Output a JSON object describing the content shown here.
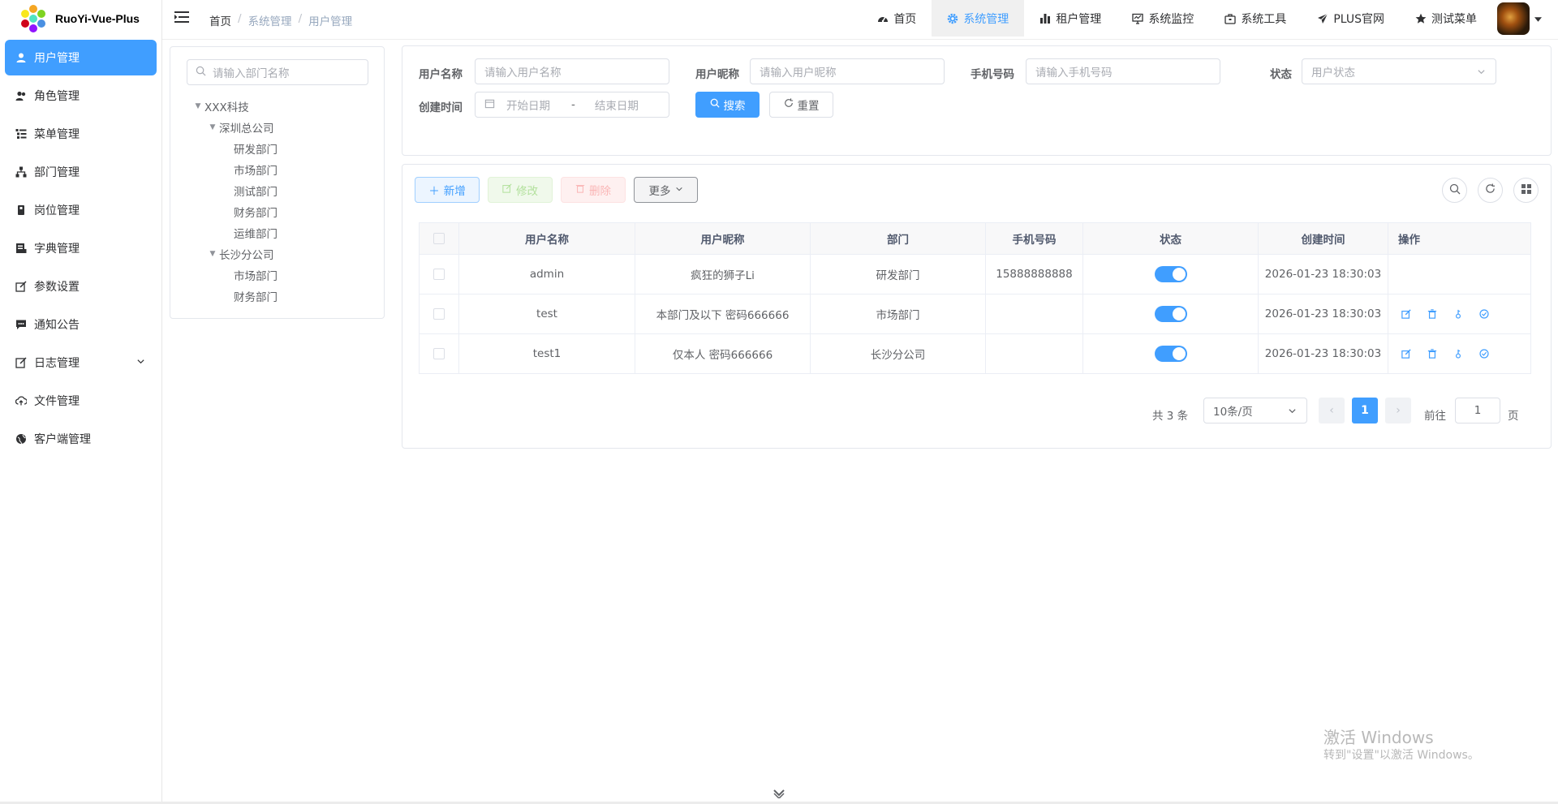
{
  "app": {
    "name": "RuoYi-Vue-Plus"
  },
  "sidebar": {
    "items": [
      {
        "label": "用户管理",
        "icon": "user-icon",
        "active": true
      },
      {
        "label": "角色管理",
        "icon": "peoples-icon"
      },
      {
        "label": "菜单管理",
        "icon": "tree-table-icon"
      },
      {
        "label": "部门管理",
        "icon": "tree-icon"
      },
      {
        "label": "岗位管理",
        "icon": "post-icon"
      },
      {
        "label": "字典管理",
        "icon": "dict-icon"
      },
      {
        "label": "参数设置",
        "icon": "edit-icon"
      },
      {
        "label": "通知公告",
        "icon": "message-icon"
      },
      {
        "label": "日志管理",
        "icon": "log-icon",
        "expandable": true
      },
      {
        "label": "文件管理",
        "icon": "upload-icon"
      },
      {
        "label": "客户端管理",
        "icon": "international-icon"
      }
    ]
  },
  "breadcrumb": [
    "首页",
    "系统管理",
    "用户管理"
  ],
  "topmenu": [
    {
      "label": "首页",
      "icon": "dashboard-icon"
    },
    {
      "label": "系统管理",
      "icon": "system-icon",
      "active": true
    },
    {
      "label": "租户管理",
      "icon": "chart-icon"
    },
    {
      "label": "系统监控",
      "icon": "monitor-icon"
    },
    {
      "label": "系统工具",
      "icon": "tool-icon"
    },
    {
      "label": "PLUS官网",
      "icon": "guide-icon"
    },
    {
      "label": "测试菜单",
      "icon": "star-icon"
    }
  ],
  "dept_tree": {
    "placeholder": "请输入部门名称",
    "root": "XXX科技",
    "branches": [
      {
        "name": "深圳总公司",
        "children": [
          "研发部门",
          "市场部门",
          "测试部门",
          "财务部门",
          "运维部门"
        ]
      },
      {
        "name": "长沙分公司",
        "children": [
          "市场部门",
          "财务部门"
        ]
      }
    ]
  },
  "search_form": {
    "username_label": "用户名称",
    "username_placeholder": "请输入用户名称",
    "nickname_label": "用户昵称",
    "nickname_placeholder": "请输入用户昵称",
    "phone_label": "手机号码",
    "phone_placeholder": "请输入手机号码",
    "status_label": "状态",
    "status_placeholder": "用户状态",
    "created_label": "创建时间",
    "start_placeholder": "开始日期",
    "range_sep": "-",
    "end_placeholder": "结束日期",
    "search_button": "搜索",
    "reset_button": "重置"
  },
  "toolbar": {
    "add": "新增",
    "edit": "修改",
    "delete": "删除",
    "more": "更多"
  },
  "table": {
    "columns": [
      "用户名称",
      "用户昵称",
      "部门",
      "手机号码",
      "状态",
      "创建时间",
      "操作"
    ],
    "rows": [
      {
        "username": "admin",
        "nickname": "疯狂的狮子Li",
        "dept": "研发部门",
        "phone": "15888888888",
        "status": true,
        "created": "2026-01-23 18:30:03",
        "has_ops": false
      },
      {
        "username": "test",
        "nickname": "本部门及以下 密码666666",
        "dept": "市场部门",
        "phone": "",
        "status": true,
        "created": "2026-01-23 18:30:03",
        "has_ops": true
      },
      {
        "username": "test1",
        "nickname": "仅本人 密码666666",
        "dept": "长沙分公司",
        "phone": "",
        "status": true,
        "created": "2026-01-23 18:30:03",
        "has_ops": true
      }
    ]
  },
  "pagination": {
    "total_text": "共 3 条",
    "page_size": "10条/页",
    "current_page": "1",
    "goto_label": "前往",
    "goto_value": "1",
    "page_suffix": "页"
  },
  "watermark": {
    "line1": "激活 Windows",
    "line2": "转到\"设置\"以激活 Windows。"
  },
  "colors": {
    "primary": "#409eff",
    "success": "#67c23a",
    "danger": "#f56c6c"
  }
}
